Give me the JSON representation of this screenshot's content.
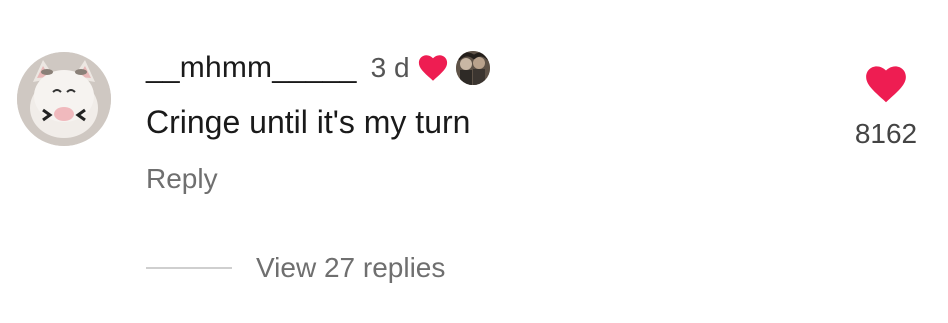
{
  "comment": {
    "username": "__mhmm_____",
    "timestamp": "3 d",
    "text": "Cringe until it's my turn",
    "reply_label": "Reply",
    "like_count": "8162",
    "view_replies_label": "View 27 replies"
  },
  "icons": {
    "avatar": "cat-avatar-icon",
    "creator_liked": "heart-icon",
    "creator_avatar": "creator-avatar-icon",
    "like": "heart-icon"
  },
  "colors": {
    "heart": "#ee1d52",
    "secondary_text": "#6f6f6f",
    "primary_text": "#1a1a1a"
  }
}
